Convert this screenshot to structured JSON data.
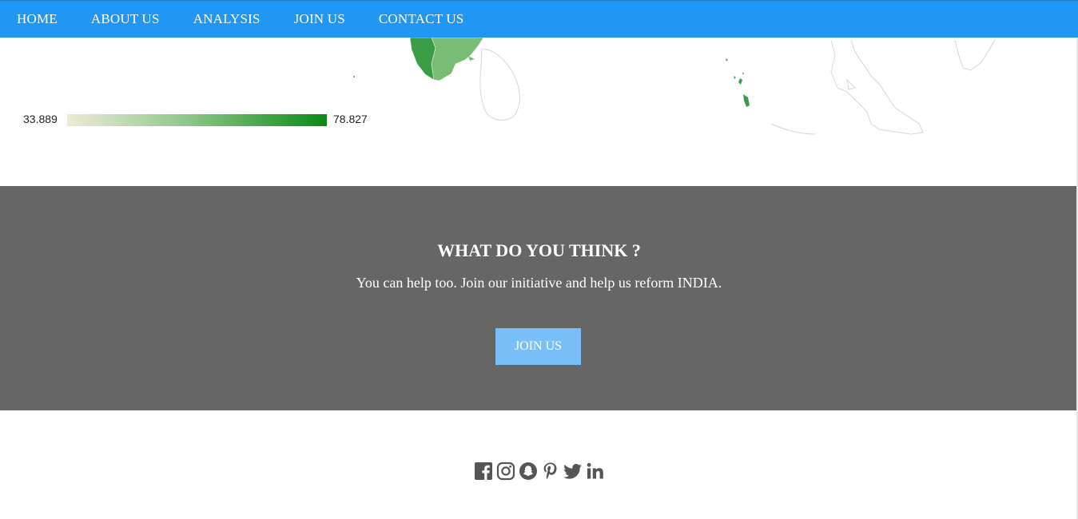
{
  "nav": {
    "items": [
      "HOME",
      "ABOUT US",
      "ANALYSIS",
      "JOIN US",
      "CONTACT US"
    ]
  },
  "legend": {
    "min": "33.889",
    "max": "78.827",
    "color_low": "#efe9d8",
    "color_high": "#0b8a14"
  },
  "cta": {
    "title": "WHAT DO YOU THINK ?",
    "text": "You can help too. Join our initiative and help us reform INDIA.",
    "button_label": "JOIN US",
    "background": "#666666",
    "button_color": "#7abef7"
  },
  "footer": {
    "social": [
      "facebook-icon",
      "instagram-icon",
      "snapchat-icon",
      "pinterest-icon",
      "twitter-icon",
      "linkedin-icon"
    ]
  },
  "colors": {
    "nav_bg": "#2196f3"
  }
}
